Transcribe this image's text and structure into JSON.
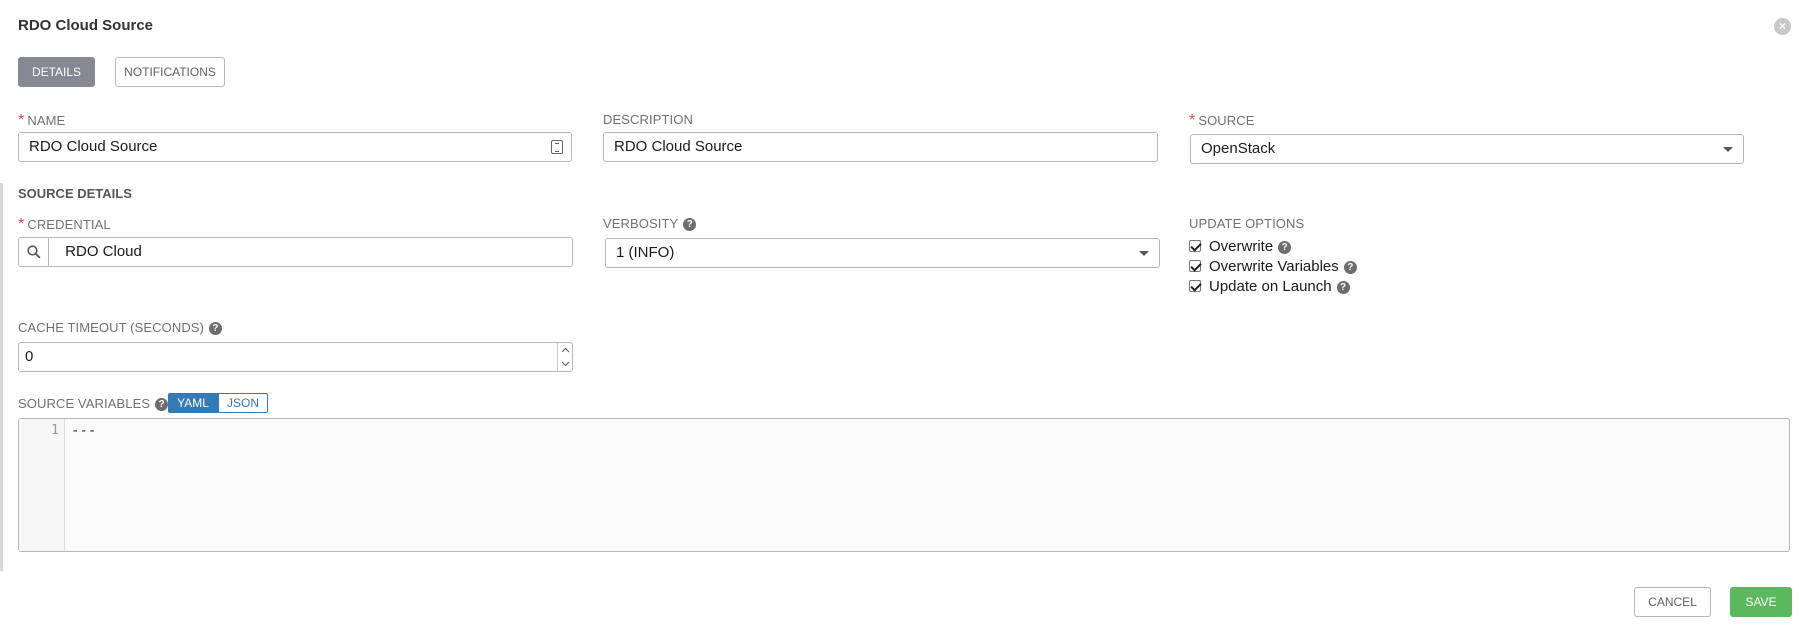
{
  "header": {
    "title": "RDO Cloud Source"
  },
  "tabs": [
    {
      "label": "DETAILS"
    },
    {
      "label": "NOTIFICATIONS"
    }
  ],
  "fields": {
    "name": {
      "label": "NAME",
      "value": "RDO Cloud Source",
      "required": true
    },
    "description": {
      "label": "DESCRIPTION",
      "value": "RDO Cloud Source"
    },
    "source": {
      "label": "SOURCE",
      "value": "OpenStack",
      "required": true
    }
  },
  "source_details": {
    "title": "SOURCE DETAILS",
    "credential": {
      "label": "CREDENTIAL",
      "value": "RDO Cloud",
      "required": true
    },
    "verbosity": {
      "label": "VERBOSITY",
      "value": "1 (INFO)"
    },
    "update_options": {
      "label": "UPDATE OPTIONS",
      "options": [
        {
          "label": "Overwrite",
          "checked": true
        },
        {
          "label": "Overwrite Variables",
          "checked": true
        },
        {
          "label": "Update on Launch",
          "checked": true
        }
      ]
    },
    "cache_timeout": {
      "label": "CACHE TIMEOUT (SECONDS)",
      "value": "0"
    },
    "source_variables": {
      "label": "SOURCE VARIABLES",
      "toggle": {
        "yaml": "YAML",
        "json": "JSON",
        "selected": "YAML"
      },
      "line_numbers": [
        "1"
      ],
      "code": "---"
    }
  },
  "actions": {
    "cancel": "CANCEL",
    "save": "SAVE"
  },
  "colors": {
    "primary_tab": "#848992",
    "save": "#5cb85c",
    "required": "#d9534f",
    "toggle_active": "#337ab7"
  },
  "icons": {
    "close": "close-icon",
    "help": "help-icon",
    "search": "search-icon",
    "name_field": "clipboard-icon"
  }
}
